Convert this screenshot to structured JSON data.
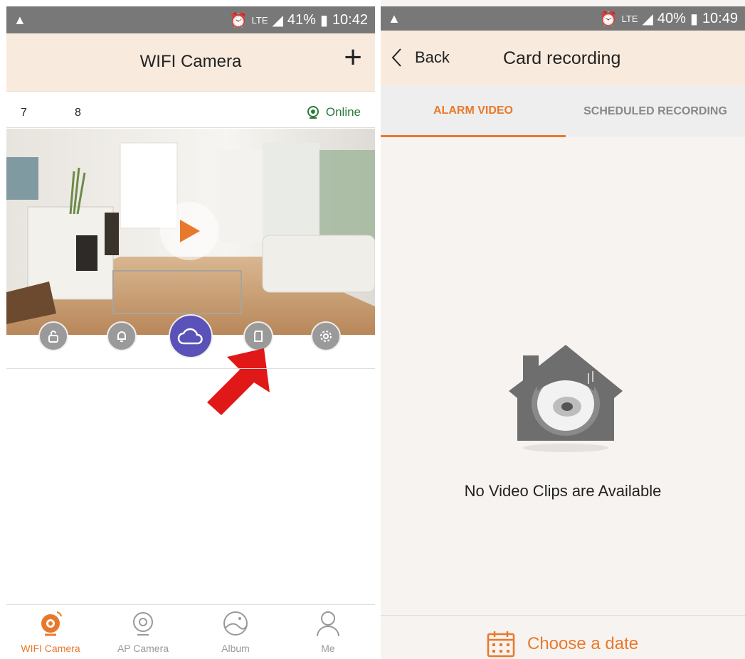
{
  "left": {
    "status": {
      "percent": "41%",
      "time": "10:42",
      "net": "LTE"
    },
    "header": {
      "title": "WIFI Camera",
      "add": "+"
    },
    "camera": {
      "name_a": "7",
      "name_b": "8",
      "status": "Online"
    },
    "controls": [
      "unlock-icon",
      "bell-icon",
      "cloud-icon",
      "sd-card-icon",
      "gear-icon"
    ],
    "tabs": [
      {
        "label": "WIFI Camera",
        "icon": "wifi-camera-icon",
        "active": true
      },
      {
        "label": "AP Camera",
        "icon": "ap-camera-icon",
        "active": false
      },
      {
        "label": "Album",
        "icon": "album-icon",
        "active": false
      },
      {
        "label": "Me",
        "icon": "person-icon",
        "active": false
      }
    ]
  },
  "right": {
    "status": {
      "percent": "40%",
      "time": "10:49",
      "net": "LTE"
    },
    "header": {
      "back": "Back",
      "title": "Card recording"
    },
    "segments": {
      "alarm": "ALARM VIDEO",
      "scheduled": "SCHEDULED RECORDING"
    },
    "empty": "No Video Clips are Available",
    "choose": "Choose a date"
  },
  "colors": {
    "accent": "#e8792c",
    "header_bg": "#f8ebde",
    "cloud": "#5a52b8",
    "online": "#2a7a3b"
  }
}
